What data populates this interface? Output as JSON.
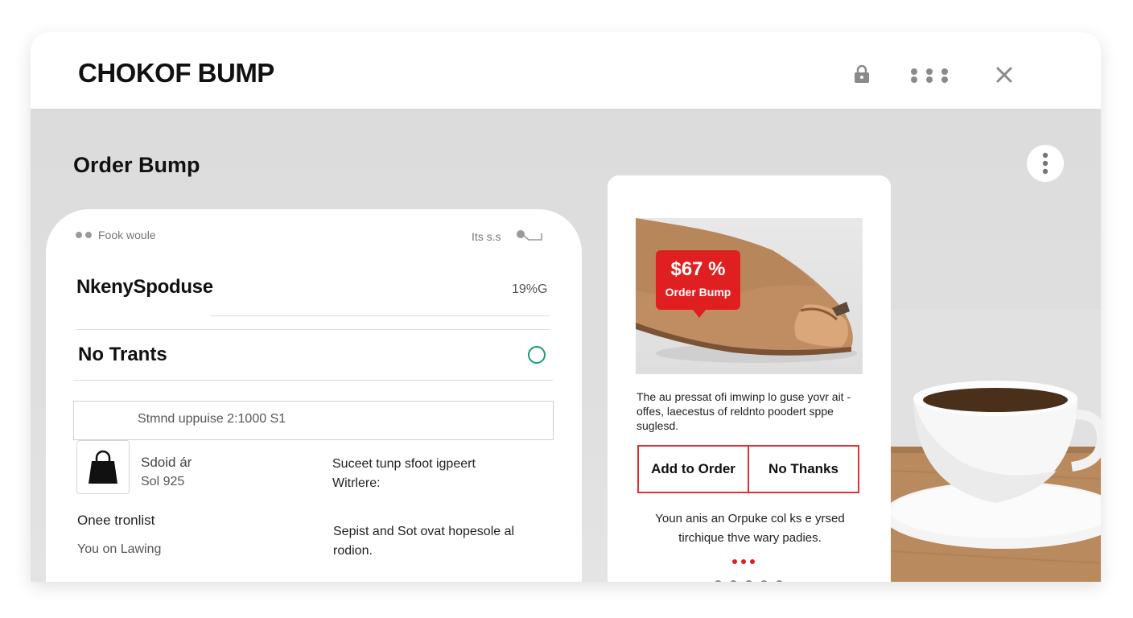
{
  "window": {
    "title": "CHOKOF BUMP",
    "icons": [
      "lock-icon",
      "more-dots-icon",
      "close-icon"
    ]
  },
  "section": {
    "title": "Order Bump"
  },
  "left_card": {
    "top_left_text": "Fook woule",
    "top_right_text": "Its s.s",
    "row1": {
      "label": "NkenySpoduse",
      "value": "19%G"
    },
    "row2": {
      "label": "No Trants"
    },
    "field_text": "Stmnd uppuise  2:1000 S1",
    "product": {
      "name": "Sdoid ár",
      "price": "Sol 925",
      "description_line1": "Sucеet tunp sfoot igpeert",
      "description_line2": "Witrlere:"
    },
    "once": {
      "label": "Onee tronlist",
      "sub": "You on Lawing"
    },
    "note": "Sepist and Sot ovat hopesole al rodion."
  },
  "offer": {
    "badge_price": "$67 %",
    "badge_currency": "$",
    "badge_label": "Order Bump",
    "text": "The au pressat ofi imwinp lo guse yovr ait - offes, laecestus of reldnto poodert sppe suglesd.",
    "add_button": "Add to Order",
    "decline_button": "No Thanks",
    "note": "Youn anis an Orpuke col ks e yrsed tirchique thve wary padies.",
    "pager_count": 5,
    "active_page": 0
  },
  "colors": {
    "accent": "#e02020",
    "radio": "#1a9a77",
    "background": "#dfdfdf"
  }
}
